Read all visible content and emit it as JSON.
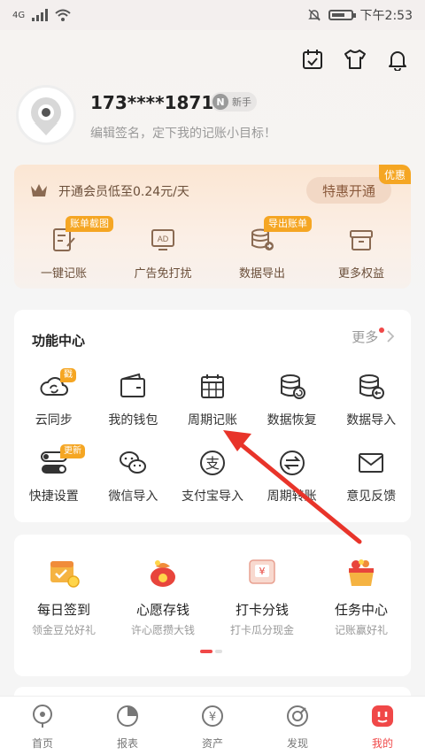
{
  "status": {
    "network": "4G",
    "time": "下午2:53"
  },
  "profile": {
    "phone": "173****1871",
    "level": "新手",
    "level_letter": "N",
    "signature": "编辑签名，定下我的记账小目标！"
  },
  "vip": {
    "text": "开通会员低至0.24元/天",
    "button": "特惠开通",
    "promo": "优惠",
    "perks": [
      {
        "label": "一键记账",
        "tag": "账单截图"
      },
      {
        "label": "广告免打扰",
        "icon_text": "AD"
      },
      {
        "label": "数据导出",
        "tag": "导出账单"
      },
      {
        "label": "更多权益"
      }
    ]
  },
  "features": {
    "title": "功能中心",
    "more": "更多",
    "items": [
      {
        "label": "云同步",
        "tag": "戳"
      },
      {
        "label": "我的钱包"
      },
      {
        "label": "周期记账"
      },
      {
        "label": "数据恢复"
      },
      {
        "label": "数据导入"
      },
      {
        "label": "快捷设置",
        "tag": "更新"
      },
      {
        "label": "微信导入"
      },
      {
        "label": "支付宝导入",
        "icon_text": "支"
      },
      {
        "label": "周期转账"
      },
      {
        "label": "意见反馈"
      }
    ]
  },
  "tasks": [
    {
      "name": "每日签到",
      "sub": "领金豆兑好礼"
    },
    {
      "name": "心愿存钱",
      "sub": "许心愿攒大钱"
    },
    {
      "name": "打卡分钱",
      "sub": "打卡瓜分现金",
      "icon_text": "¥"
    },
    {
      "name": "任务中心",
      "sub": "记账赢好礼"
    }
  ],
  "tabs": [
    {
      "label": "首页"
    },
    {
      "label": "报表"
    },
    {
      "label": "资产",
      "icon_text": "¥"
    },
    {
      "label": "发现"
    },
    {
      "label": "我的"
    }
  ],
  "colors": {
    "accent": "#f04848",
    "promo": "#f5a623",
    "vip_text": "#6b4f3a"
  }
}
